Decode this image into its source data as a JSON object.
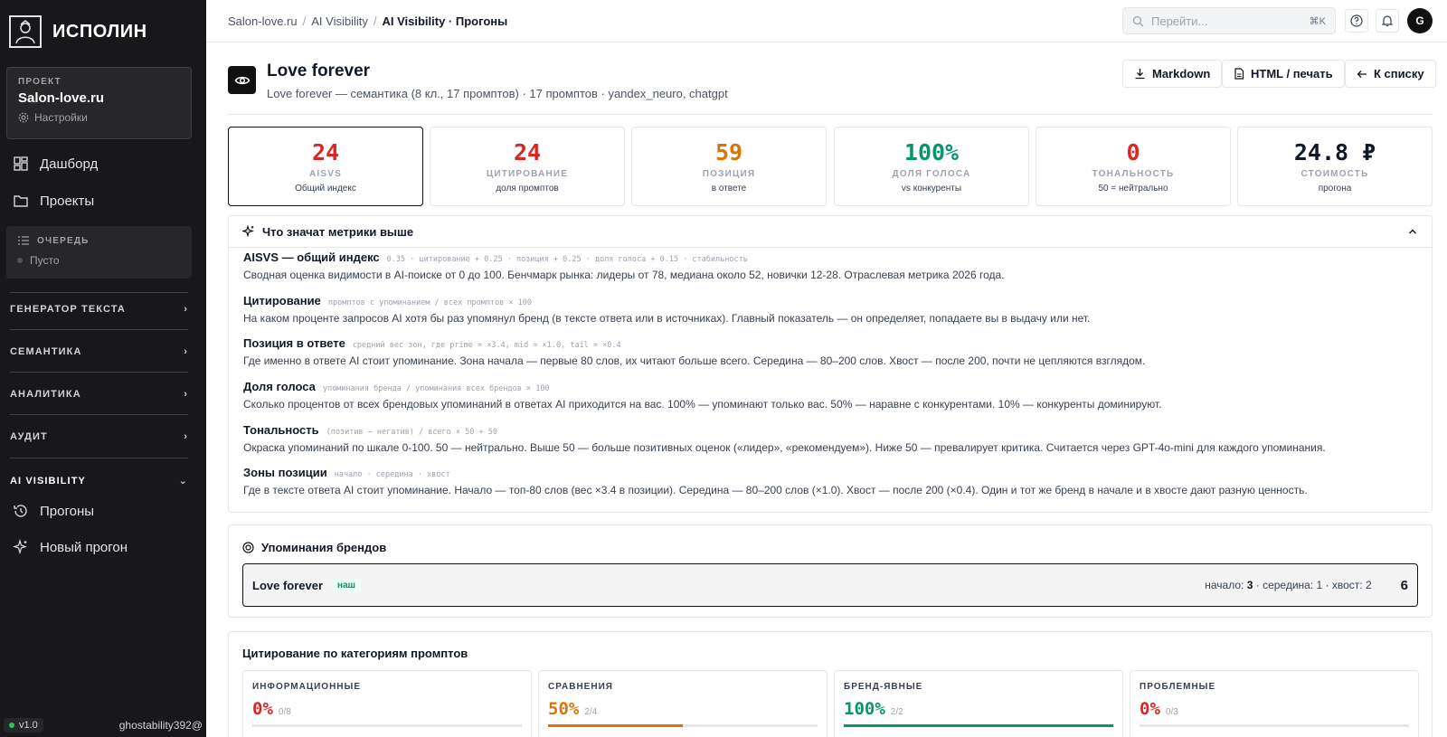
{
  "sidebar": {
    "brand": "ИСПОЛИН",
    "project_caption": "ПРОЕКТ",
    "project_name": "Salon-love.ru",
    "settings_label": "Настройки",
    "nav_dashboard": "Дашборд",
    "nav_projects": "Проекты",
    "queue_title": "ОЧЕРЕДЬ",
    "queue_status": "Пусто",
    "sections": [
      "ГЕНЕРАТОР ТЕКСТА",
      "СЕМАНТИКА",
      "АНАЛИТИКА",
      "АУДИТ",
      "AI VISIBILITY"
    ],
    "sub_runs": "Прогоны",
    "sub_new_run": "Новый прогон",
    "version": "v1.0",
    "user": "ghostability392@"
  },
  "topbar": {
    "crumbs": [
      "Salon-love.ru",
      "AI Visibility",
      "AI Visibility · Прогоны"
    ],
    "search_placeholder": "Перейти...",
    "search_kbd": "⌘K",
    "avatar_letter": "G"
  },
  "header": {
    "title": "Love forever",
    "subtitle": "Love forever — семантика (8 кл., 17 промптов) · 17 промптов · yandex_neuro, chatgpt",
    "btn_markdown": "Markdown",
    "btn_html": "HTML / печать",
    "btn_back": "К списку"
  },
  "metrics": [
    {
      "value": "24",
      "name": "AISVS",
      "desc": "Общий индекс",
      "color": "#dc2626"
    },
    {
      "value": "24",
      "name": "ЦИТИРОВАНИЕ",
      "desc": "доля промптов",
      "color": "#dc2626"
    },
    {
      "value": "59",
      "name": "ПОЗИЦИЯ",
      "desc": "в ответе",
      "color": "#d97706"
    },
    {
      "value": "100%",
      "name": "ДОЛЯ ГОЛОСА",
      "desc": "vs конкуренты",
      "color": "#059669"
    },
    {
      "value": "0",
      "name": "ТОНАЛЬНОСТЬ",
      "desc": "50 = нейтрально",
      "color": "#dc2626"
    },
    {
      "value": "24.8 ₽",
      "name": "СТОИМОСТЬ",
      "desc": "прогона",
      "color": "#111827"
    }
  ],
  "explain": {
    "title": "Что значат метрики выше",
    "items": [
      {
        "title": "AISVS — общий индекс",
        "formula": "0.35 · цитирование + 0.25 · позиция + 0.25 · доля голоса + 0.15 · стабильность",
        "text": "Сводная оценка видимости в AI-поиске от 0 до 100. Бенчмарк рынка: лидеры от 78, медиана около 52, новички 12-28. Отраслевая метрика 2026 года."
      },
      {
        "title": "Цитирование",
        "formula": "промптов с упоминанием / всех промптов × 100",
        "text": "На каком проценте запросов AI хотя бы раз упомянул бренд (в тексте ответа или в источниках). Главный показатель — он определяет, попадаете вы в выдачу или нет."
      },
      {
        "title": "Позиция в ответе",
        "formula": "средний вес зон, где prime = ×3.4, mid = ×1.0, tail = ×0.4",
        "text": "Где именно в ответе AI стоит упоминание. Зона начала — первые 80 слов, их читают больше всего. Середина — 80–200 слов. Хвост — после 200, почти не цепляются взглядом."
      },
      {
        "title": "Доля голоса",
        "formula": "упоминания бренда / упоминания всех брендов × 100",
        "text": "Сколько процентов от всех брендовых упоминаний в ответах AI приходится на вас. 100% — упоминают только вас. 50% — наравне с конкурентами. 10% — конкуренты доминируют."
      },
      {
        "title": "Тональность",
        "formula": "(позитив − негатив) / всего × 50 + 50",
        "text": "Окраска упоминаний по шкале 0-100. 50 — нейтрально. Выше 50 — больше позитивных оценок («лидер», «рекомендуем»). Ниже 50 — превалирует критика. Считается через GPT-4o-mini для каждого упоминания."
      },
      {
        "title": "Зоны позиции",
        "formula": "начало · середина · хвост",
        "text": "Где в тексте ответа AI стоит упоминание. Начало — топ-80 слов (вес ×3.4 в позиции). Середина — 80–200 слов (×1.0). Хвост — после 200 (×0.4). Один и тот же бренд в начале и в хвосте дают разную ценность."
      }
    ]
  },
  "brands": {
    "title": "Упоминания брендов",
    "rows": [
      {
        "name": "Love forever",
        "tag": "наш",
        "zone_start_label": "начало:",
        "zone_start": "3",
        "zone_mid_label": "· середина:",
        "zone_mid": "1",
        "zone_tail_label": "· хвост:",
        "zone_tail": "2",
        "total": "6"
      }
    ]
  },
  "categories": {
    "title": "Цитирование по категориям промптов",
    "items": [
      {
        "name": "ИНФОРМАЦИОННЫЕ",
        "pct": "0%",
        "frac": "0/8",
        "fill": 0,
        "color": "#dc2626"
      },
      {
        "name": "СРАВНЕНИЯ",
        "pct": "50%",
        "frac": "2/4",
        "fill": 0.5,
        "color": "#d97706"
      },
      {
        "name": "БРЕНД-ЯВНЫЕ",
        "pct": "100%",
        "frac": "2/2",
        "fill": 1,
        "color": "#059669"
      },
      {
        "name": "ПРОБЛЕМНЫЕ",
        "pct": "0%",
        "frac": "0/3",
        "fill": 0,
        "color": "#dc2626"
      }
    ]
  }
}
